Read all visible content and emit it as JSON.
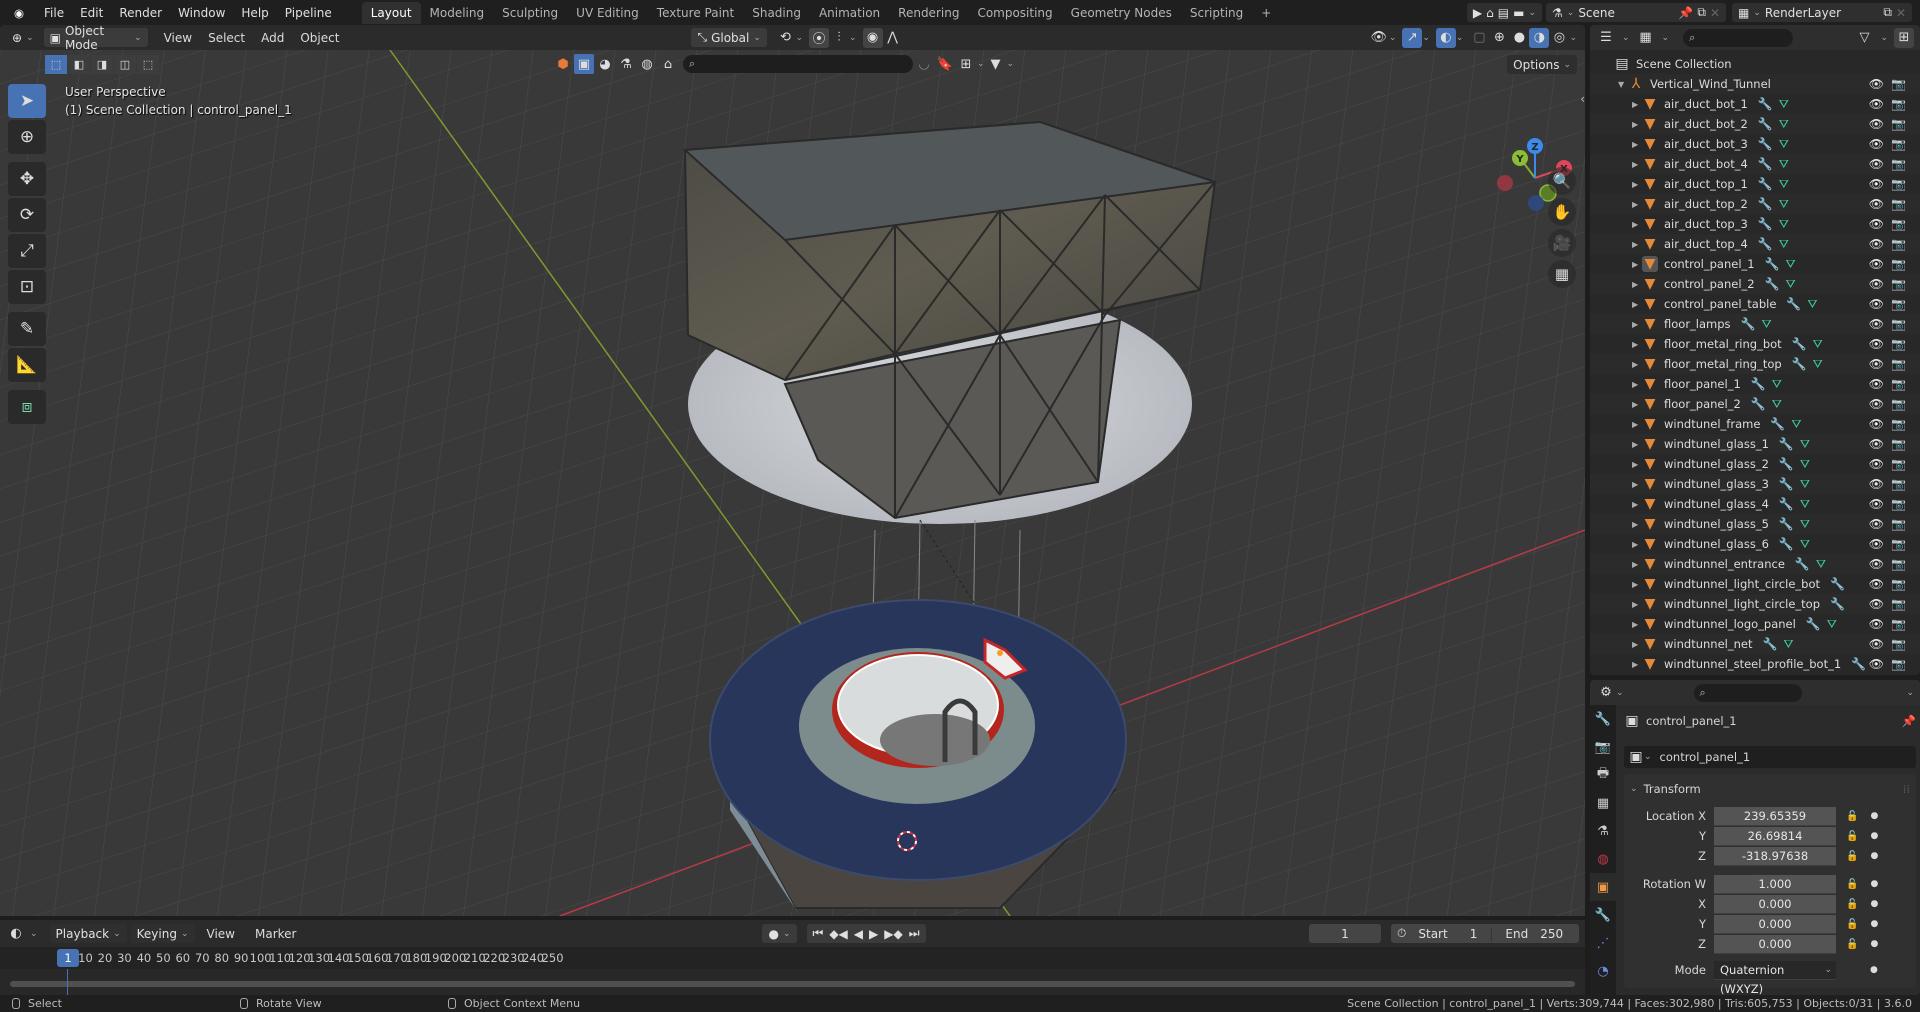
{
  "topbar": {
    "menus": [
      "File",
      "Edit",
      "Render",
      "Window",
      "Help",
      "Pipeline"
    ],
    "workspaces": [
      "Layout",
      "Modeling",
      "Sculpting",
      "UV Editing",
      "Texture Paint",
      "Shading",
      "Animation",
      "Rendering",
      "Compositing",
      "Geometry Nodes",
      "Scripting"
    ],
    "active_workspace": "Layout",
    "add_workspace": "+",
    "scene_name": "Scene",
    "view_layer": "RenderLayer"
  },
  "viewport_header": {
    "mode": "Object Mode",
    "menus": [
      "View",
      "Select",
      "Add",
      "Object"
    ],
    "transform_orientation": "Global",
    "options_label": "Options"
  },
  "viewport": {
    "view_name": "User Perspective",
    "context": "(1) Scene Collection | control_panel_1",
    "gizmo_axes": [
      "X",
      "Y",
      "Z"
    ],
    "colors": {
      "x_axis": "#e8455a",
      "y_axis": "#8bbd35",
      "z_axis": "#3c8bea",
      "grid": "#4a4a4a",
      "background": "#393939"
    }
  },
  "toolbar": {
    "tools": [
      "select-box",
      "cursor",
      "move",
      "rotate",
      "scale",
      "transform",
      "annotate",
      "measure",
      "add-cube"
    ],
    "active": "select-box"
  },
  "outliner": {
    "root": "Scene Collection",
    "collection": "Vertical_Wind_Tunnel",
    "items": [
      {
        "name": "air_duct_bot_1",
        "mesh": true
      },
      {
        "name": "air_duct_bot_2",
        "mesh": true
      },
      {
        "name": "air_duct_bot_3",
        "mesh": true
      },
      {
        "name": "air_duct_bot_4",
        "mesh": true
      },
      {
        "name": "air_duct_top_1",
        "mesh": true
      },
      {
        "name": "air_duct_top_2",
        "mesh": true
      },
      {
        "name": "air_duct_top_3",
        "mesh": true
      },
      {
        "name": "air_duct_top_4",
        "mesh": true
      },
      {
        "name": "control_panel_1",
        "mesh": true,
        "active": true
      },
      {
        "name": "control_panel_2",
        "mesh": true
      },
      {
        "name": "control_panel_table",
        "mesh": true
      },
      {
        "name": "floor_lamps",
        "mesh": true
      },
      {
        "name": "floor_metal_ring_bot",
        "mesh": true
      },
      {
        "name": "floor_metal_ring_top",
        "mesh": true
      },
      {
        "name": "floor_panel_1",
        "mesh": true
      },
      {
        "name": "floor_panel_2",
        "mesh": true
      },
      {
        "name": "windtunel_frame",
        "mesh": true
      },
      {
        "name": "windtunel_glass_1",
        "mesh": true
      },
      {
        "name": "windtunel_glass_2",
        "mesh": true
      },
      {
        "name": "windtunel_glass_3",
        "mesh": true
      },
      {
        "name": "windtunel_glass_4",
        "mesh": true
      },
      {
        "name": "windtunel_glass_5",
        "mesh": true
      },
      {
        "name": "windtunel_glass_6",
        "mesh": true
      },
      {
        "name": "windtunnel_entrance",
        "mesh": true
      },
      {
        "name": "windtunnel_light_circle_bot",
        "mesh": false
      },
      {
        "name": "windtunnel_light_circle_top",
        "mesh": false
      },
      {
        "name": "windtunnel_logo_panel",
        "mesh": true
      },
      {
        "name": "windtunnel_net",
        "mesh": true
      },
      {
        "name": "windtunnel_steel_profile_bot_1",
        "mesh": false
      }
    ]
  },
  "properties": {
    "object_name": "control_panel_1",
    "datablock_name": "control_panel_1",
    "panel_title": "Transform",
    "location": {
      "label": "Location X",
      "x": "239.65359",
      "y": "26.69814",
      "z": "-318.97638"
    },
    "rotation": {
      "label": "Rotation W",
      "w": "1.000",
      "x": "0.000",
      "y": "0.000",
      "z": "0.000"
    },
    "axis_labels": {
      "x": "X",
      "y": "Y",
      "z": "Z"
    },
    "mode_label": "Mode",
    "mode_value": "Quaternion (WXYZ)"
  },
  "timeline": {
    "menus": [
      "Playback",
      "Keying",
      "View",
      "Marker"
    ],
    "current_frame": "1",
    "start_label": "Start",
    "start": "1",
    "end_label": "End",
    "end": "250",
    "ticks": [
      "10",
      "20",
      "30",
      "40",
      "50",
      "60",
      "70",
      "80",
      "90",
      "100",
      "110",
      "120",
      "130",
      "140",
      "150",
      "160",
      "170",
      "180",
      "190",
      "200",
      "210",
      "220",
      "230",
      "240",
      "250"
    ]
  },
  "statusbar": {
    "left_click": "Select",
    "middle_click": "Rotate View",
    "right_click": "Object Context Menu",
    "stats": "Scene Collection | control_panel_1 | Verts:309,744 | Faces:302,980 | Tris:605,753 | Objects:0/31 | 3.6.0"
  }
}
